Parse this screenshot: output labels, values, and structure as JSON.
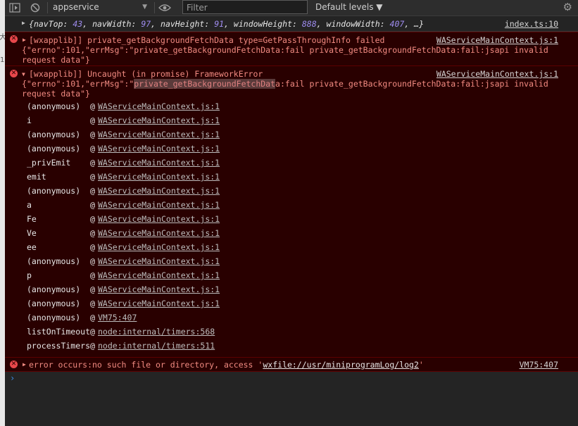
{
  "left_strip": {
    "chars": [
      "大",
      "1"
    ]
  },
  "toolbar": {
    "context": "appservice",
    "filter_placeholder": "Filter",
    "levels": "Default levels ▼"
  },
  "log_info": {
    "text_prefix": "{",
    "pairs": [
      {
        "key": "navTop",
        "value": "43"
      },
      {
        "key": "navWidth",
        "value": "97"
      },
      {
        "key": "navHeight",
        "value": "91"
      },
      {
        "key": "windowHeight",
        "value": "888"
      },
      {
        "key": "windowWidth",
        "value": "407"
      }
    ],
    "text_suffix": ", …}",
    "source": "index.ts:10"
  },
  "error1": {
    "line1": "[wxapplib]] private_getBackgroundFetchData type=GetPassThroughInfo failed",
    "line2": "{\"errno\":101,\"errMsg\":\"private_getBackgroundFetchData:fail private_getBackgroundFetchData:fail:jsapi invalid",
    "line3": "request data\"}",
    "source": "WAServiceMainContext.js:1"
  },
  "error2": {
    "line1": "[wxapplib]] Uncaught (in promise) FrameworkError",
    "line2_pre": "{\"errno\":101,\"errMsg\":\"",
    "line2_hl": "private_getBackgroundFetchDat",
    "line2_post": "a:fail private_getBackgroundFetchData:fail:jsapi invalid",
    "line3": "request data\"}",
    "source": "WAServiceMainContext.js:1",
    "at": "@",
    "frames": [
      {
        "name": "(anonymous)",
        "src": "WAServiceMainContext.js:1"
      },
      {
        "name": "i",
        "src": "WAServiceMainContext.js:1"
      },
      {
        "name": "(anonymous)",
        "src": "WAServiceMainContext.js:1"
      },
      {
        "name": "(anonymous)",
        "src": "WAServiceMainContext.js:1"
      },
      {
        "name": "_privEmit",
        "src": "WAServiceMainContext.js:1"
      },
      {
        "name": "emit",
        "src": "WAServiceMainContext.js:1"
      },
      {
        "name": "(anonymous)",
        "src": "WAServiceMainContext.js:1"
      },
      {
        "name": "a",
        "src": "WAServiceMainContext.js:1"
      },
      {
        "name": "Fe",
        "src": "WAServiceMainContext.js:1"
      },
      {
        "name": "Ve",
        "src": "WAServiceMainContext.js:1"
      },
      {
        "name": "ee",
        "src": "WAServiceMainContext.js:1"
      },
      {
        "name": "(anonymous)",
        "src": "WAServiceMainContext.js:1"
      },
      {
        "name": "p",
        "src": "WAServiceMainContext.js:1"
      },
      {
        "name": "(anonymous)",
        "src": "WAServiceMainContext.js:1"
      },
      {
        "name": "(anonymous)",
        "src": "WAServiceMainContext.js:1"
      },
      {
        "name": "(anonymous)",
        "src": "VM75:407"
      },
      {
        "name": "listOnTimeout",
        "src": "node:internal/timers:568"
      },
      {
        "name": "processTimers",
        "src": "node:internal/timers:511"
      }
    ]
  },
  "error3": {
    "pre": "error occurs:no such file or directory, access '",
    "path": "wxfile://usr/miniprogramLog/log2",
    "post": "'",
    "source": "VM75:407"
  },
  "prompt": "›",
  "colors": {
    "error_bg": "#290000",
    "error_text": "#f28b82",
    "error_icon": "#e8474b",
    "prompt": "#3c8ce7"
  }
}
